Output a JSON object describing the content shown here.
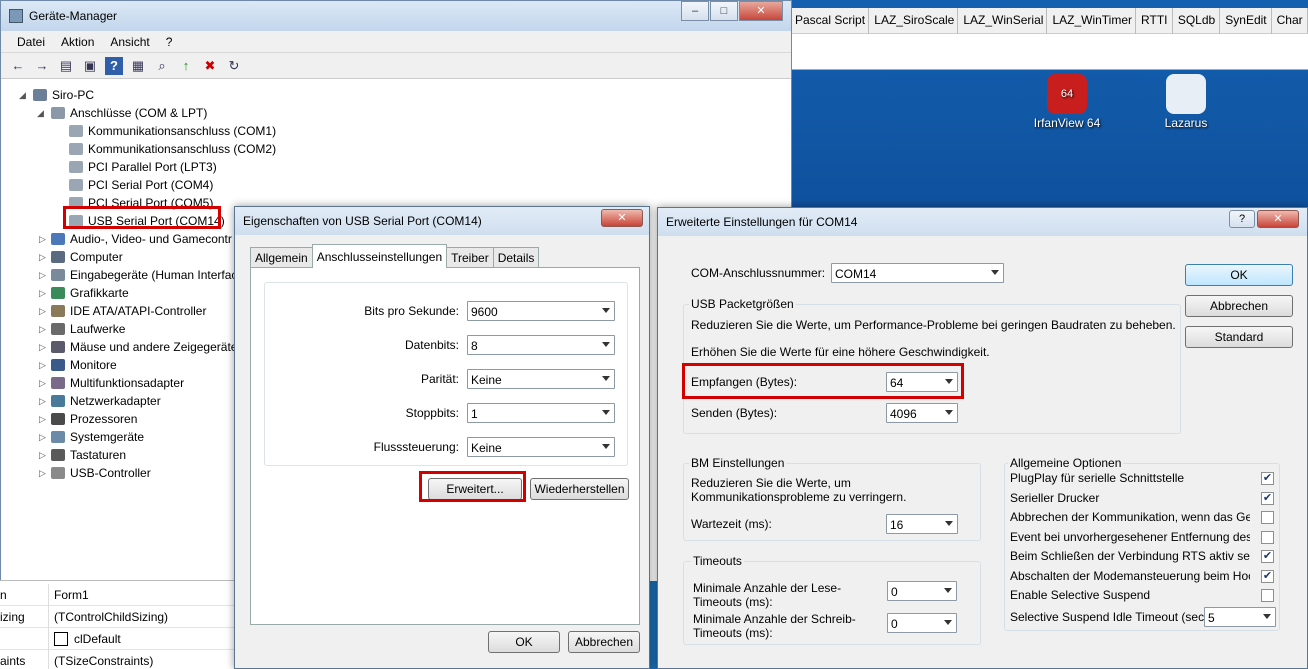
{
  "ide": {
    "tabs": [
      "Pascal Script",
      "LAZ_SiroScale",
      "LAZ_WinSerial",
      "LAZ_WinTimer",
      "RTTI",
      "SQLdb",
      "SynEdit",
      "Char"
    ]
  },
  "desktop": {
    "icons": [
      {
        "label": "IrfanView 64",
        "badge": "64",
        "color": "#c81e1e"
      },
      {
        "label": "Lazarus",
        "color": "#e8eef6"
      }
    ]
  },
  "devmgr": {
    "title": "Geräte-Manager",
    "menu": [
      "Datei",
      "Aktion",
      "Ansicht",
      "?"
    ],
    "root": "Siro-PC",
    "ports_group": "Anschlüsse (COM & LPT)",
    "ports": [
      "Kommunikationsanschluss (COM1)",
      "Kommunikationsanschluss (COM2)",
      "PCI Parallel Port (LPT3)",
      "PCI Serial Port (COM4)",
      "PCI Serial Port (COM5)",
      "USB Serial Port (COM14)"
    ],
    "categories": [
      "Audio-, Video- und Gamecontr",
      "Computer",
      "Eingabegeräte (Human Interfac",
      "Grafikkarte",
      "IDE ATA/ATAPI-Controller",
      "Laufwerke",
      "Mäuse und andere Zeigegeräte",
      "Monitore",
      "Multifunktionsadapter",
      "Netzwerkadapter",
      "Prozessoren",
      "Systemgeräte",
      "Tastaturen",
      "USB-Controller"
    ]
  },
  "props": {
    "rows": [
      {
        "k": "n",
        "v": "Form1"
      },
      {
        "k": "izing",
        "v": "(TControlChildSizing)"
      },
      {
        "k": "",
        "v": "clDefault"
      },
      {
        "k": "aints",
        "v": "(TSizeConstraints)"
      }
    ]
  },
  "port_dialog": {
    "title": "Eigenschaften von USB Serial Port (COM14)",
    "tabs": [
      "Allgemein",
      "Anschlusseinstellungen",
      "Treiber",
      "Details"
    ],
    "fields": [
      {
        "label": "Bits pro Sekunde:",
        "value": "9600"
      },
      {
        "label": "Datenbits:",
        "value": "8"
      },
      {
        "label": "Parität:",
        "value": "Keine"
      },
      {
        "label": "Stoppbits:",
        "value": "1"
      },
      {
        "label": "Flusssteuerung:",
        "value": "Keine"
      }
    ],
    "advanced_btn": "Erweitert...",
    "restore_btn": "Wiederherstellen",
    "ok": "OK",
    "cancel": "Abbrechen"
  },
  "adv_dialog": {
    "title": "Erweiterte Einstellungen für COM14",
    "help": "?",
    "com_label": "COM-Anschlussnummer:",
    "com_value": "COM14",
    "ok": "OK",
    "cancel": "Abbrechen",
    "standard": "Standard",
    "usb_group": "USB Packetgrößen",
    "usb_text1": "Reduzieren Sie die Werte, um Performance-Probleme bei geringen Baudraten zu beheben.",
    "usb_text2": "Erhöhen Sie die Werte für eine höhere Geschwindigkeit.",
    "recv_label": "Empfangen (Bytes):",
    "recv_value": "64",
    "send_label": "Senden (Bytes):",
    "send_value": "4096",
    "bm_group": "BM Einstellungen",
    "bm_text": "Reduzieren Sie die Werte, um Kommunikationsprobleme zu verringern.",
    "latency_label": "Wartezeit (ms):",
    "latency_value": "16",
    "timeouts_group": "Timeouts",
    "read_timeout_label": "Minimale Anzahle der Lese-Timeouts (ms):",
    "read_timeout_value": "0",
    "write_timeout_label": "Minimale Anzahle der Schreib-Timeouts (ms):",
    "write_timeout_value": "0",
    "misc_group": "Allgemeine Optionen",
    "options": [
      {
        "label": "PlugPlay für serielle Schnittstelle",
        "checked": true
      },
      {
        "label": "Serieller Drucker",
        "checked": true
      },
      {
        "label": "Abbrechen der Kommunikation, wenn das Gerät ausgeschaltet wird",
        "checked": false
      },
      {
        "label": "Event bei unvorhergesehener Entfernung des Geräts",
        "checked": false
      },
      {
        "label": "Beim Schließen der Verbindung RTS aktiv setzen",
        "checked": true
      },
      {
        "label": "Abschalten der Modemansteuerung beim Hochfahren des Geräts",
        "checked": true
      },
      {
        "label": "Enable Selective Suspend",
        "checked": false
      }
    ],
    "suspend_label": "Selective Suspend Idle Timeout (secs):",
    "suspend_value": "5"
  }
}
